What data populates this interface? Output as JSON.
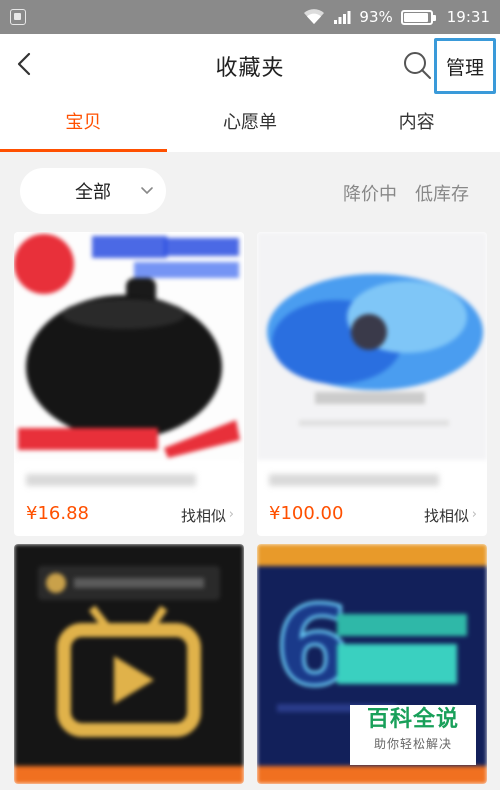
{
  "status_bar": {
    "battery_percent": "93%",
    "time": "19:31",
    "battery_level": 0.93
  },
  "header": {
    "title": "收藏夹",
    "manage_label": "管理"
  },
  "tabs": [
    {
      "label": "宝贝",
      "active": true
    },
    {
      "label": "心愿单",
      "active": false
    },
    {
      "label": "内容",
      "active": false
    }
  ],
  "filter": {
    "selected": "全部",
    "links": [
      "降价中",
      "低库存"
    ]
  },
  "products": [
    {
      "price": "¥16.88",
      "similar_label": "找相似"
    },
    {
      "price": "¥100.00",
      "similar_label": "找相似"
    },
    {},
    {}
  ],
  "watermark": {
    "title": "百科全说",
    "subtitle": "助你轻松解决"
  },
  "colors": {
    "accent": "#ff5000",
    "highlight_border": "#3a9ad9",
    "watermark_green": "#19a05a"
  }
}
